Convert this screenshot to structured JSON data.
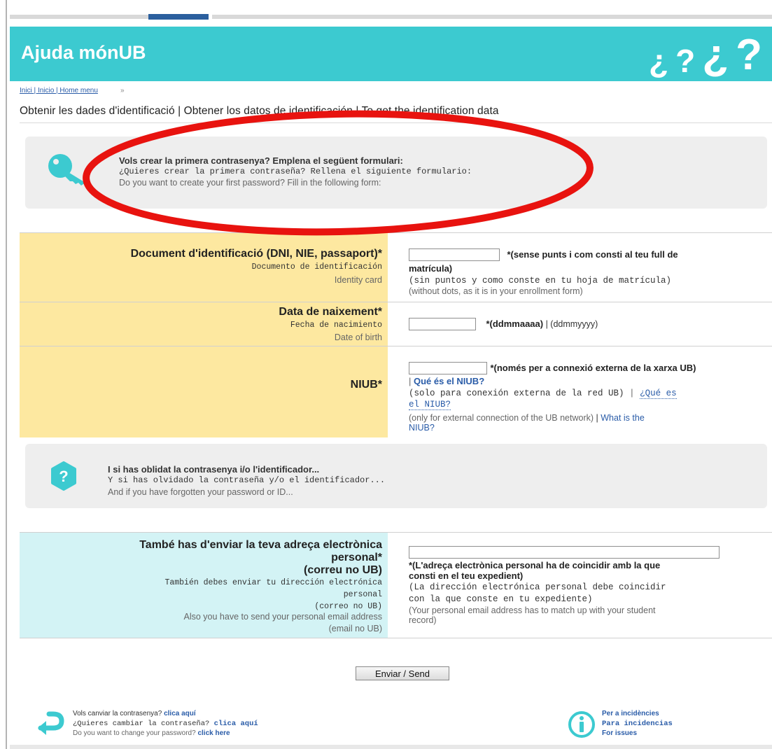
{
  "header": {
    "title": "Ajuda mónUB",
    "question_marks": [
      "¿",
      "?",
      "¿",
      "?"
    ]
  },
  "breadcrumb": {
    "link": "Inici | Inicio | Home menu",
    "separator": "»"
  },
  "page_title": "Obtenir les dades d'identificació | Obtener los datos de identificación | To get the identification data",
  "create_box": {
    "icon": "key-icon",
    "ca": "Vols crear la primera contrasenya? Emplena el següent formulari:",
    "es": "¿Quieres crear la primera contraseña? Rellena el siguiente formulario:",
    "en": "Do you want to create your first password? Fill in the following form:"
  },
  "annotation": {
    "shape": "ellipse",
    "color": "#e8130f"
  },
  "form": {
    "document": {
      "label_ca": "Document d'identificació (DNI, NIE, passaport)*",
      "label_es": "Documento de identificación",
      "label_en": "Identity card",
      "input_value": "",
      "hint_ca_1": "*(sense punts i com consti al teu full de",
      "hint_ca_2": "matrícula)",
      "hint_es": "(sin puntos y como conste en tu hoja de matrícula)",
      "hint_en": "(without dots, as it is in your enrollment form)"
    },
    "birth": {
      "label_ca": "Data de naixement*",
      "label_es": "Fecha de nacimiento",
      "label_en": "Date of birth",
      "input_value": "",
      "hint_bold": "*(ddmmaaaa)",
      "hint_rest": " | (ddmmyyyy)"
    },
    "niub": {
      "label": "NIUB*",
      "input_value": "",
      "hint_ca": "*(només per a connexió externa de la xarxa UB)",
      "link_ca": "Qué és el NIUB?",
      "hint_es": "(solo para conexión externa de la red UB)",
      "link_es_1": "¿Qué es",
      "link_es_2": "el NIUB?",
      "hint_en": "(only for external connection of the UB network)",
      "link_en_1": "What is the",
      "link_en_2": "NIUB?"
    },
    "email": {
      "label_ca_1": "També has d'enviar la teva adreça electrònica",
      "label_ca_2": "personal*",
      "label_ca_3": "(correu no UB)",
      "label_es_1": "También debes enviar tu dirección electrónica",
      "label_es_2": "personal",
      "label_es_3": "(correo no UB)",
      "label_en_1": "Also you have to send your personal email address",
      "label_en_2": "(email no UB)",
      "input_value": "",
      "hint_ca_1": "*(L'adreça electrònica personal ha de coincidir amb la que",
      "hint_ca_2": "consti en el teu expedient)",
      "hint_es_1": "(La dirección electrónica personal debe coincidir",
      "hint_es_2": "con la que conste en tu expediente)",
      "hint_en_1": "(Your personal email address has to match up with your student",
      "hint_en_2": "record)"
    }
  },
  "forgot_box": {
    "icon": "question-icon",
    "ca": "I si has oblidat la contrasenya i/o l'identificador...",
    "es": "Y si has olvidado la contraseña y/o el identificador...",
    "en": "And if you have forgotten your password or ID..."
  },
  "send_button": "Enviar / Send",
  "footer": {
    "change": {
      "ca": "Vols canviar la contrasenya?",
      "ca_link": "clica aquí",
      "es": "¿Quieres cambiar la contraseña?",
      "es_link": "clica aquí",
      "en": "Do you want to change your password?",
      "en_link": "click here"
    },
    "issues": {
      "ca": "Per a incidències",
      "es": "Para incidencias",
      "en": "For issues"
    }
  },
  "colors": {
    "header": "#3ccad0",
    "label_bg": "#fde8a0",
    "email_label_bg": "#d3f3f5",
    "link": "#2a5ca8",
    "annotation": "#e8130f"
  }
}
